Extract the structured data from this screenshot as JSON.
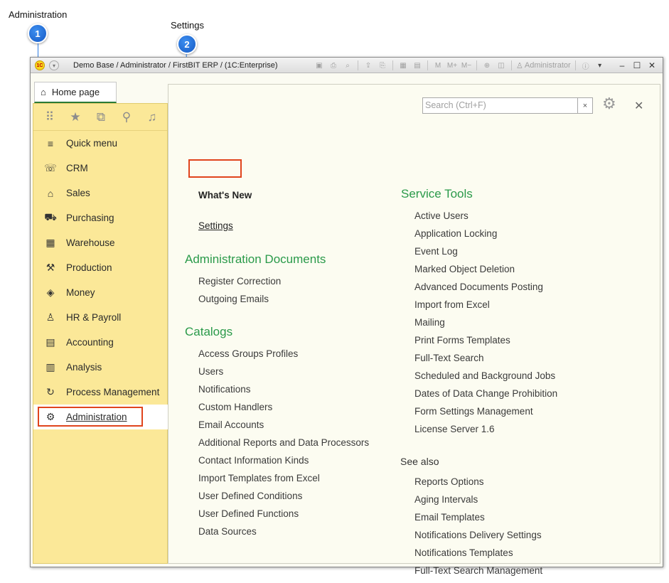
{
  "annotations": [
    {
      "label": "Administration",
      "number": "1"
    },
    {
      "label": "Settings",
      "number": "2"
    }
  ],
  "titlebar": {
    "title": "Demo Base / Administrator / FirstBIT ERP /  (1C:Enterprise)",
    "user": "Administrator",
    "icons": [
      "save-icon",
      "print-icon",
      "print-preview-icon",
      "upload-icon",
      "download-icon",
      "calculator-icon",
      "calendar-icon",
      "memory-icon",
      "memory-plus-icon",
      "memory-minus-icon",
      "zoom-icon",
      "layout-icon"
    ]
  },
  "tab": {
    "label": "Home page"
  },
  "sidebar": {
    "tools": [
      "apps-grid-icon",
      "star-icon",
      "history-icon",
      "search-icon",
      "bell-icon"
    ],
    "items": [
      {
        "label": "Quick menu",
        "icon": "≡"
      },
      {
        "label": "CRM",
        "icon": "☏"
      },
      {
        "label": "Sales",
        "icon": "⌂"
      },
      {
        "label": "Purchasing",
        "icon": "⛟"
      },
      {
        "label": "Warehouse",
        "icon": "▦"
      },
      {
        "label": "Production",
        "icon": "⚒"
      },
      {
        "label": "Money",
        "icon": "◈"
      },
      {
        "label": "HR & Payroll",
        "icon": "♙"
      },
      {
        "label": "Accounting",
        "icon": "▤"
      },
      {
        "label": "Analysis",
        "icon": "▥"
      },
      {
        "label": "Process Management",
        "icon": "↻"
      },
      {
        "label": "Administration",
        "icon": "⚙"
      }
    ]
  },
  "search": {
    "placeholder": "Search (Ctrl+F)",
    "clear": "×"
  },
  "content": {
    "whats_new": "What's New",
    "settings": "Settings",
    "admin_docs": {
      "title": "Administration Documents",
      "items": [
        "Register Correction",
        "Outgoing Emails"
      ]
    },
    "catalogs": {
      "title": "Catalogs",
      "items": [
        "Access Groups Profiles",
        "Users",
        "Notifications",
        "Custom Handlers",
        "Email Accounts",
        "Additional Reports and Data Processors",
        "Contact Information Kinds",
        "Import Templates from Excel",
        "User Defined Conditions",
        "User Defined Functions",
        "Data Sources"
      ]
    },
    "service_tools": {
      "title": "Service Tools",
      "items": [
        "Active Users",
        "Application Locking",
        "Event Log",
        "Marked Object Deletion",
        "Advanced Documents Posting",
        "Import from Excel",
        "Mailing",
        "Print Forms Templates",
        "Full-Text Search",
        "Scheduled and Background Jobs",
        "Dates of Data Change Prohibition",
        "Form Settings Management",
        "License Server 1.6"
      ]
    },
    "see_also": {
      "title": "See also",
      "items": [
        "Reports Options",
        "Aging Intervals",
        "Email Templates",
        "Notifications Delivery Settings",
        "Notifications Templates",
        "Full-Text Search Management"
      ]
    }
  },
  "colors": {
    "accent_green": "#2a9a4a",
    "sidebar_bg": "#fbe898",
    "highlight": "#e0441c",
    "badge": "#1f6fe0"
  }
}
